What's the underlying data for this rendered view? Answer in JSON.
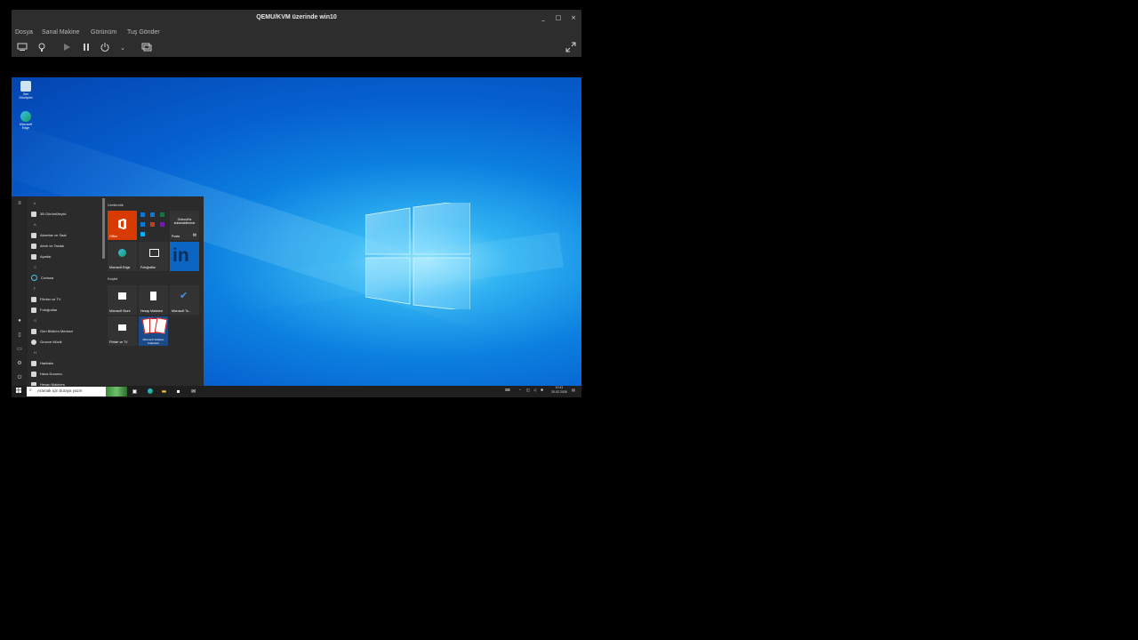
{
  "window": {
    "title": "QEMU/KVM üzerinde win10",
    "controls": {
      "minimize": "_",
      "maximize": "□",
      "close": "×"
    }
  },
  "menu": [
    "Dosya",
    "Sanal Makine",
    "Görünüm",
    "Tuş Gönder"
  ],
  "toolbar": {
    "icons": [
      "monitor-icon",
      "lightbulb-icon",
      "play-icon",
      "pause-icon",
      "power-icon",
      "chevron-down-icon",
      "screenshot-icon",
      "fullscreen-icon"
    ]
  },
  "desktop": {
    "icons": [
      {
        "label": "Geri Dönüşüm",
        "icon": "recycle-bin-icon"
      },
      {
        "label": "Microsoft Edge",
        "icon": "edge-icon"
      }
    ]
  },
  "start_menu": {
    "apps": [
      {
        "type": "header",
        "label": "#"
      },
      {
        "type": "app",
        "label": "3B Görüntüleyici"
      },
      {
        "type": "header",
        "label": "A"
      },
      {
        "type": "app",
        "label": "Alarmlar ve Saat"
      },
      {
        "type": "app",
        "label": "Alıntı ve Taslak"
      },
      {
        "type": "app",
        "label": "Ayarlar"
      },
      {
        "type": "header",
        "label": "C"
      },
      {
        "type": "app",
        "label": "Cortana"
      },
      {
        "type": "header",
        "label": "F"
      },
      {
        "type": "app",
        "label": "Filmler ve TV"
      },
      {
        "type": "app",
        "label": "Fotoğraflar"
      },
      {
        "type": "header",
        "label": "G"
      },
      {
        "type": "app",
        "label": "Geri Bildirim Merkezi"
      },
      {
        "type": "app",
        "label": "Groove Müzik"
      },
      {
        "type": "header",
        "label": "H"
      },
      {
        "type": "app",
        "label": "Haritalar"
      },
      {
        "type": "app",
        "label": "Hava Durumu"
      },
      {
        "type": "app",
        "label": "Hesap Makinesi"
      }
    ],
    "groups": {
      "productivity": "Üretkenlik",
      "explore": "Keşfet"
    },
    "tiles": [
      {
        "label": "Office",
        "color": "#d83b01"
      },
      {
        "label": "",
        "color": "#2b2b2b"
      },
      {
        "label": "Outlook'ta kullanabilirsiniz",
        "color": "#333333"
      },
      {
        "label": "Microsoft Edge",
        "color": "#333333"
      },
      {
        "label": "Fotoğraflar",
        "color": "#333333"
      },
      {
        "label": "",
        "color": "#0a66c2"
      },
      {
        "label": "Microsoft Store",
        "color": "#333333"
      },
      {
        "label": "Hesap Makinesi",
        "color": "#333333"
      },
      {
        "label": "Microsoft To...",
        "color": "#333333"
      },
      {
        "label": "Filmler ve TV",
        "color": "#333333"
      },
      {
        "label": "Microsoft Solitaire Collection",
        "color": "#1a4a8a"
      }
    ],
    "posta_label": "Posta"
  },
  "taskbar": {
    "search_placeholder": "Aramak için buraya yazın",
    "time": "10:41",
    "date": "20.02.2026"
  },
  "colors": {
    "accent": "#0a78d7",
    "office": "#d83b01",
    "linkedin": "#0a66c2"
  }
}
